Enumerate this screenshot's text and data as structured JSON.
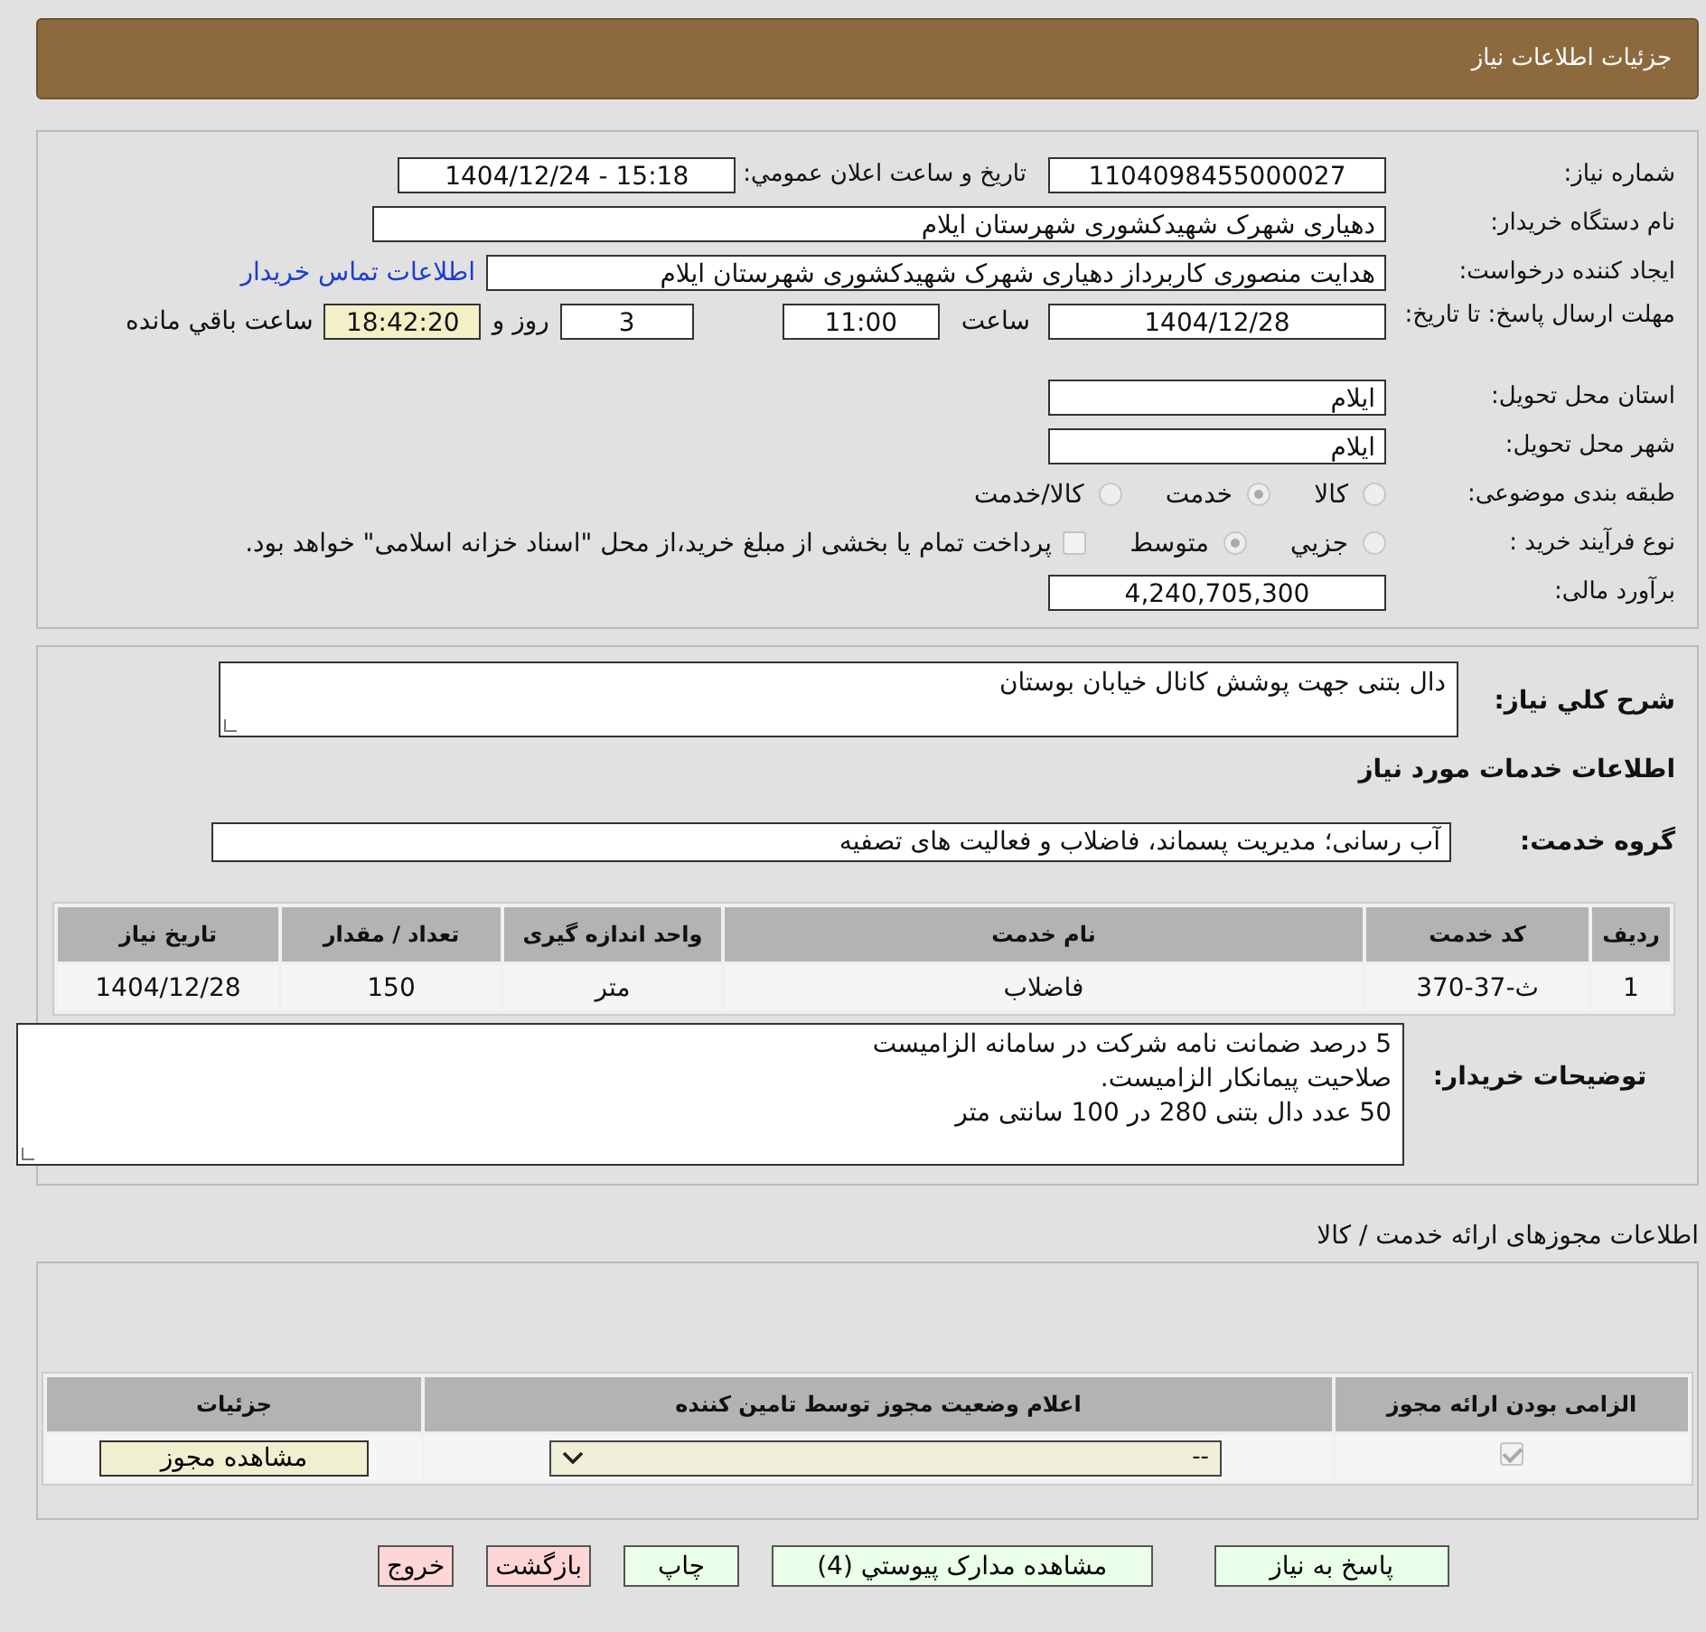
{
  "header": {
    "title": "جزئیات اطلاعات نیاز"
  },
  "need_number": {
    "label": "شماره نیاز:",
    "value": "1104098455000027"
  },
  "announce": {
    "label": "تاریخ و ساعت اعلان عمومي:",
    "value": "1404/12/24 - 15:18"
  },
  "buyer_org": {
    "label": "نام دستگاه خریدار:",
    "value": "دهیاری شهرک شهیدکشوری شهرستان ایلام"
  },
  "requester": {
    "label": "ایجاد کننده درخواست:",
    "value": "هدایت منصوری کاربرداز دهیاری شهرک شهیدکشوری شهرستان ایلام",
    "link": "اطلاعات تماس خریدار"
  },
  "deadline": {
    "label": "مهلت ارسال پاسخ: تا تاریخ:",
    "date": "1404/12/28",
    "time_label": "ساعت",
    "time": "11:00",
    "days": "3",
    "days_label": "روز و",
    "remaining": "18:42:20",
    "remaining_label": "ساعت باقي مانده"
  },
  "province": {
    "label": "استان محل تحویل:",
    "value": "ایلام"
  },
  "city": {
    "label": "شهر محل تحویل:",
    "value": "ایلام"
  },
  "category": {
    "label": "طبقه بندی موضوعی:",
    "options": [
      {
        "label": "كالا",
        "selected": false
      },
      {
        "label": "خدمت",
        "selected": true
      },
      {
        "label": "كالا/خدمت",
        "selected": false
      }
    ]
  },
  "process": {
    "label": "نوع فرآیند خرید :",
    "options": [
      {
        "label": "جزيي",
        "selected": false
      },
      {
        "label": "متوسط",
        "selected": true
      }
    ],
    "treasury": {
      "label": "پرداخت تمام یا بخشی از مبلغ خرید،از محل \"اسناد خزانه اسلامی\" خواهد بود.",
      "checked": false
    }
  },
  "budget": {
    "label": "برآورد مالی:",
    "value": "4,240,705,300"
  },
  "description": {
    "label": "شرح کلي نیاز:",
    "value": "دال بتنی جهت پوشش کانال خیابان بوستان"
  },
  "services_title": "اطلاعات خدمات مورد نیاز",
  "service_group": {
    "label": "گروه خدمت:",
    "value": "آب رسانی؛ مدیریت پسماند، فاضلاب و فعالیت های تصفیه"
  },
  "services_table": {
    "columns": [
      "ردیف",
      "کد خدمت",
      "نام خدمت",
      "واحد اندازه گیری",
      "تعداد / مقدار",
      "تاریخ نیاز"
    ],
    "rows": [
      [
        "1",
        "ث-37-370",
        "فاضلاب",
        "متر",
        "150",
        "1404/12/28"
      ]
    ]
  },
  "buyer_notes": {
    "label": "توضیحات خریدار:",
    "value": "5 درصد ضمانت نامه شرکت در سامانه الزامیست\nصلاحیت پیمانکار الزامیست.\n50 عدد دال بتنی 280 در 100 سانتی متر"
  },
  "permits_title": "اطلاعات مجوزهای ارائه خدمت / کالا",
  "permits_table": {
    "columns": [
      "الزامی بودن ارائه مجوز",
      "اعلام وضعیت مجوز توسط تامین کننده",
      "جزئیات"
    ],
    "rows": [
      {
        "required": true,
        "status": "--",
        "button": "مشاهده مجوز"
      }
    ]
  },
  "buttons": [
    {
      "label": "پاسخ به نیاز",
      "kind": "normal"
    },
    {
      "label": "مشاهده مدارک پیوستي (4)",
      "kind": "normal"
    },
    {
      "label": "چاپ",
      "kind": "normal"
    },
    {
      "label": "بازگشت",
      "kind": "exit"
    },
    {
      "label": "خروج",
      "kind": "exit"
    }
  ]
}
